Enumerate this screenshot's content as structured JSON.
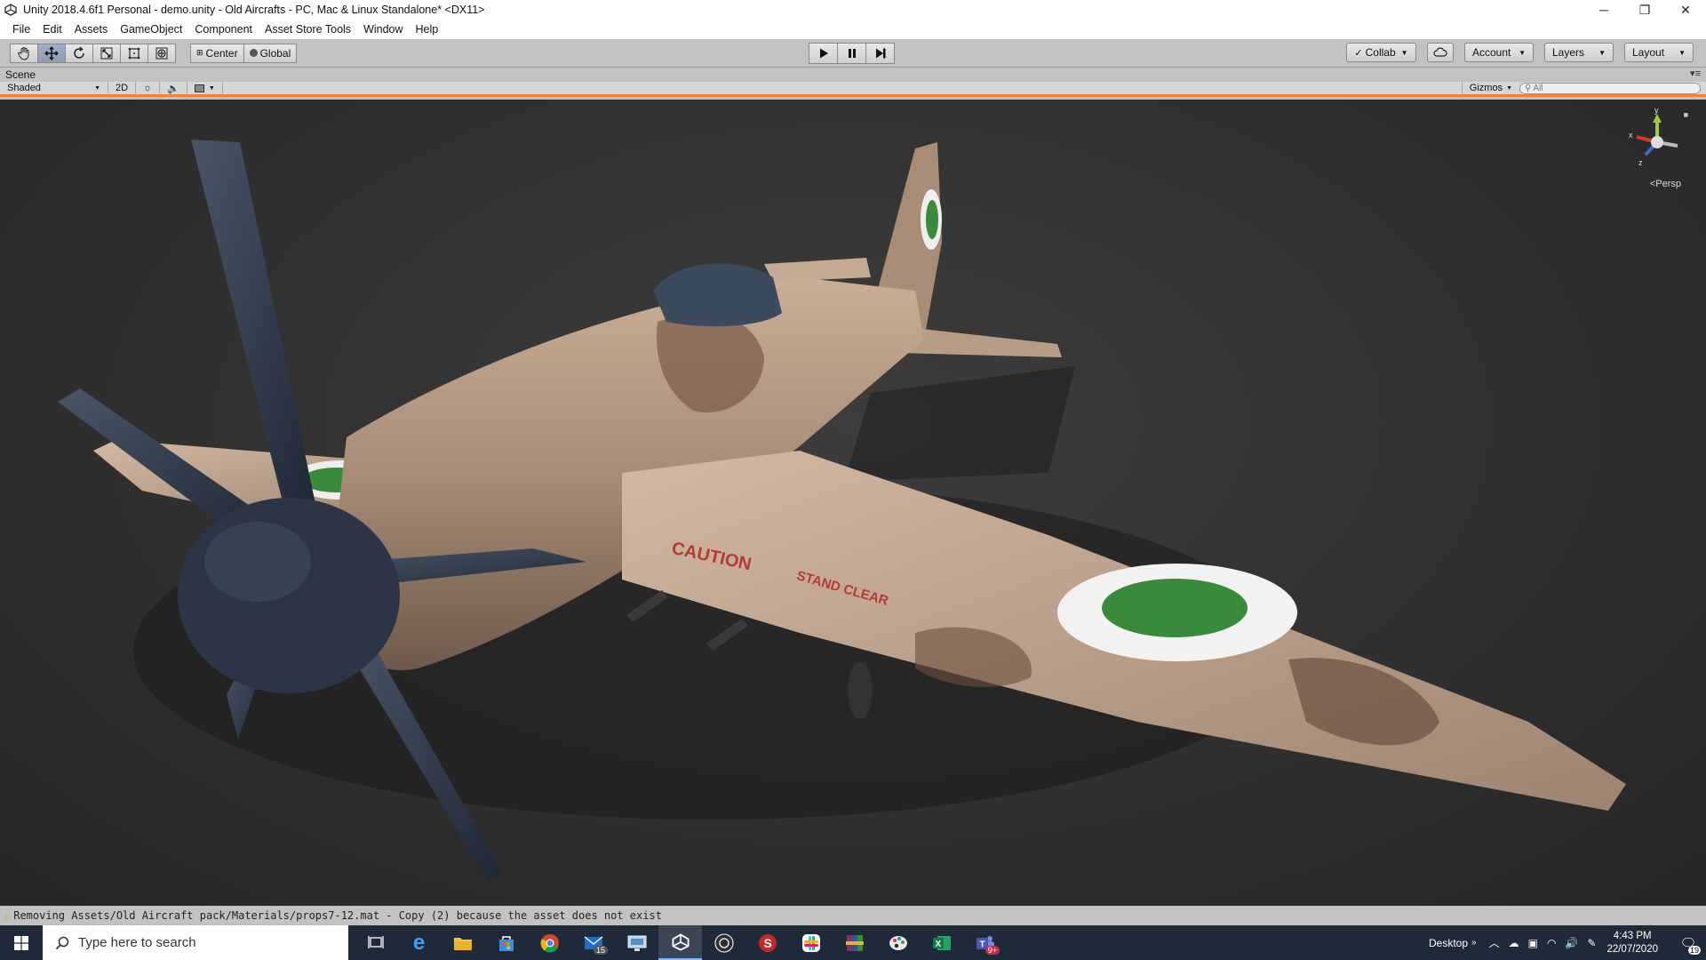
{
  "window": {
    "title": "Unity 2018.4.6f1 Personal - demo.unity - Old Aircrafts - PC, Mac & Linux Standalone* <DX11>",
    "minimize_glyph": "─",
    "restore_glyph": "❐",
    "close_glyph": "✕"
  },
  "menu": [
    "File",
    "Edit",
    "Assets",
    "GameObject",
    "Component",
    "Asset Store Tools",
    "Window",
    "Help"
  ],
  "toolbar": {
    "pivot_label": "Center",
    "space_label": "Global",
    "collab_label": "Collab",
    "account_label": "Account",
    "layers_label": "Layers",
    "layout_label": "Layout"
  },
  "scene": {
    "tab_label": "Scene",
    "shading_mode": "Shaded",
    "mode_2d": "2D",
    "gizmos_label": "Gizmos",
    "search_placeholder": "All",
    "persp_label": "Persp",
    "axis_y": "y",
    "axis_x": "x",
    "axis_z": "z",
    "decal_caution": "CAUTION",
    "decal_stand_clear": "STAND CLEAR"
  },
  "status": {
    "message": "Removing Assets/Old Aircraft pack/Materials/props7-12.mat - Copy (2) because the asset does not exist"
  },
  "taskbar": {
    "search_placeholder": "Type here to search",
    "mail_badge": "15",
    "teams_badge": "9+",
    "desktop_label": "Desktop",
    "time": "4:43 PM",
    "date": "22/07/2020",
    "notifications_count": "19"
  },
  "colors": {
    "accent_orange": "#f0803c",
    "roundel_green": "#3a8a3c",
    "fuselage_tan": "#a88c76"
  }
}
